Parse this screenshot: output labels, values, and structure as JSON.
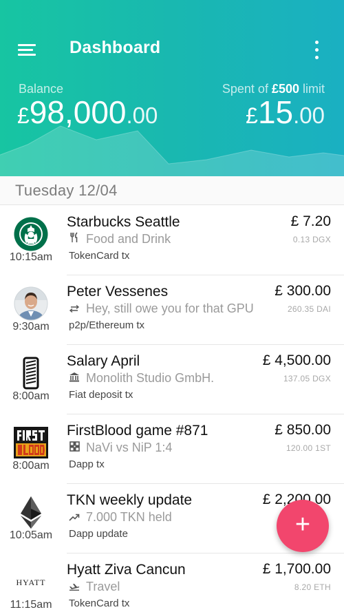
{
  "header": {
    "title": "Dashboard",
    "balance_label": "Balance",
    "balance_currency": "£",
    "balance_whole": "98,000",
    "balance_decimal": ".00",
    "spent_prefix": "Spent of ",
    "spent_limit": "£500",
    "spent_suffix": " limit",
    "spent_currency": "£",
    "spent_whole": "15",
    "spent_decimal": ".00"
  },
  "date_header": "Tuesday 12/04",
  "transactions": [
    {
      "name": "Starbucks Seattle",
      "icon": "utensils-icon",
      "subtitle": "Food and Drink",
      "type": "TokenCard tx",
      "amount": "£ 7.20",
      "token": "0.13 DGX",
      "time": "10:15am",
      "avatar": "starbucks-logo"
    },
    {
      "name": "Peter Vessenes",
      "icon": "transfer-icon",
      "subtitle": "Hey, still owe you for that GPU",
      "type": "p2p/Ethereum tx",
      "amount": "£ 300.00",
      "token": "260.35 DAI",
      "time": "9:30am",
      "avatar": "person-photo"
    },
    {
      "name": "Salary April",
      "icon": "bank-icon",
      "subtitle": "Monolith Studio GmbH.",
      "type": "Fiat deposit tx",
      "amount": "£ 4,500.00",
      "token": "137.05 DGX",
      "time": "8:00am",
      "avatar": "monolith-logo"
    },
    {
      "name": "FirstBlood game #871",
      "icon": "game-icon",
      "subtitle": "NaVi vs NiP 1:4",
      "type": "Dapp tx",
      "amount": "£ 850.00",
      "token": "120.00 1ST",
      "time": "8:00am",
      "avatar": "firstblood-logo"
    },
    {
      "name": "TKN weekly update",
      "icon": "trending-icon",
      "subtitle": "7.000 TKN held",
      "type": "Dapp update",
      "amount": "£ 2,200.00",
      "token": "",
      "time": "10:05am",
      "avatar": "ethereum-logo"
    },
    {
      "name": "Hyatt Ziva Cancun",
      "icon": "plane-icon",
      "subtitle": "Travel",
      "type": "TokenCard tx",
      "amount": "£ 1,700.00",
      "token": "8.20 ETH",
      "time": "11:15am",
      "avatar": "hyatt-logo"
    }
  ],
  "fab": {
    "label": "+"
  },
  "colors": {
    "header_start": "#17c5a2",
    "header_end": "#1ab0c2",
    "fab": "#f2466d"
  }
}
